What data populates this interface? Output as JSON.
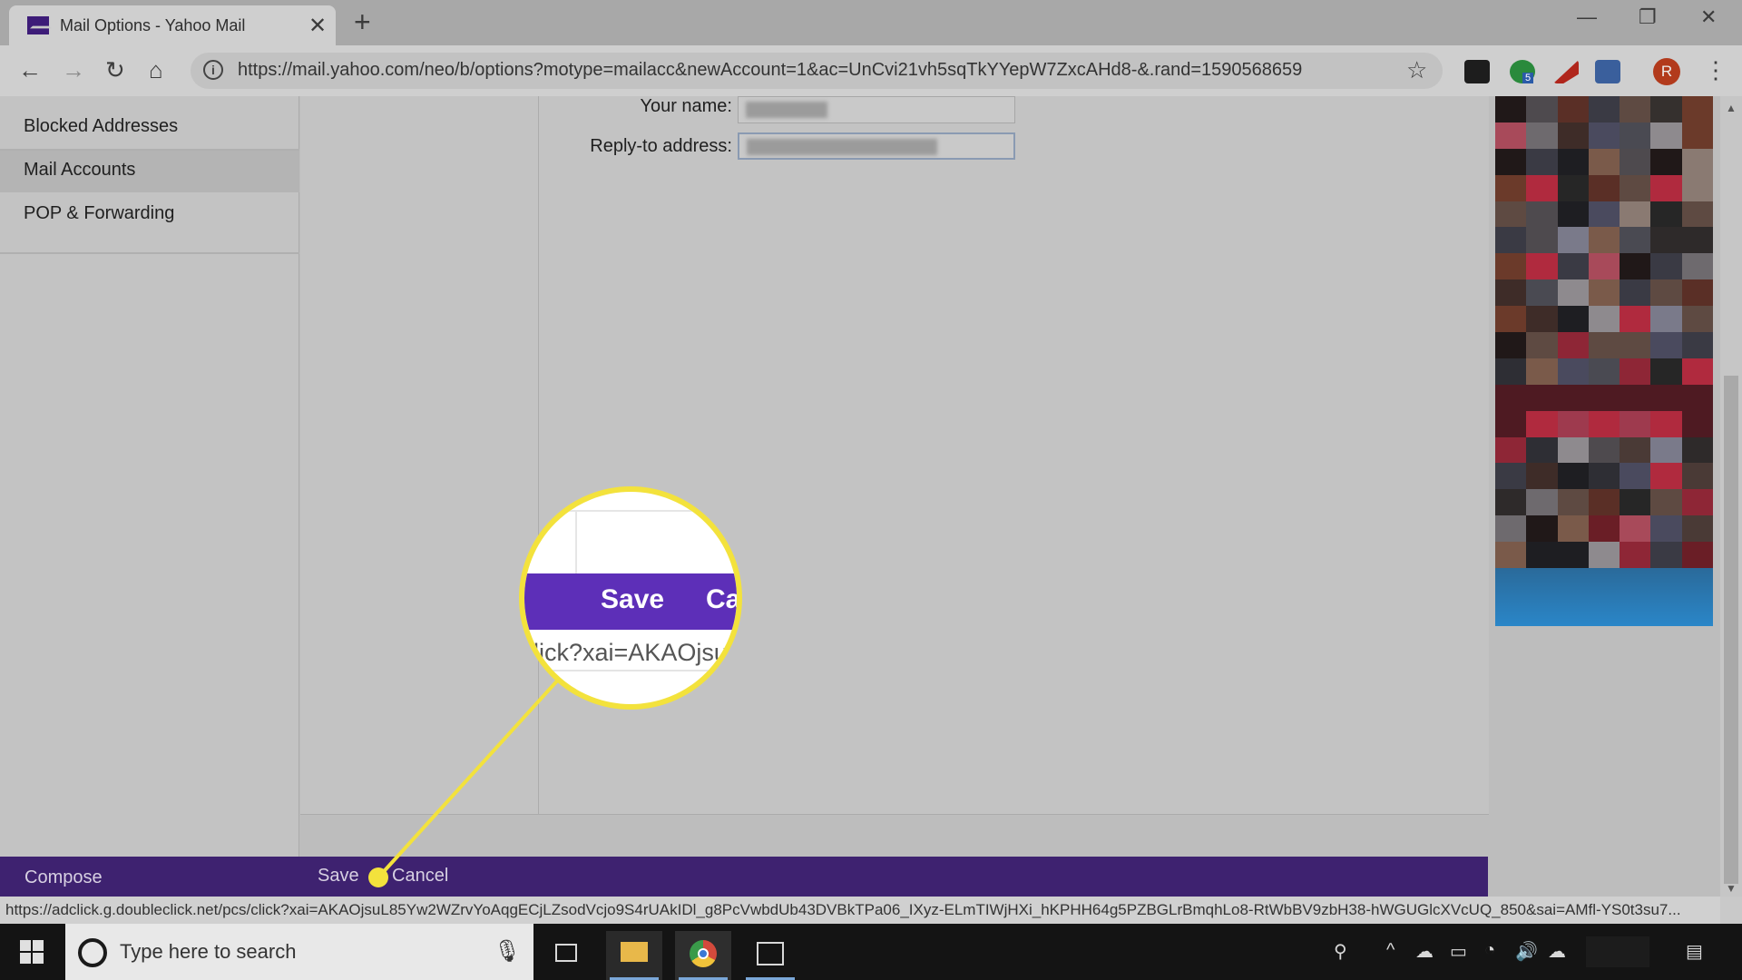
{
  "browser": {
    "tab_title": "Mail Options - Yahoo Mail",
    "tab_close": "✕",
    "new_tab": "+",
    "window": {
      "minimize": "—",
      "restore": "❐",
      "close": "✕"
    },
    "url": "https://mail.yahoo.com/neo/b/options?motype=mailacc&newAccount=1&ac=UnCvi21vh5sqTkYYepW7ZxcAHd8-&.rand=1590568659",
    "extension_badge": "5",
    "avatar_letter": "R",
    "icons": [
      "back-arrow",
      "forward-arrow",
      "reload",
      "home",
      "info",
      "star",
      "menu-dots"
    ]
  },
  "sidebar": {
    "items": [
      {
        "label": "Blocked Addresses"
      },
      {
        "label": "Mail Accounts",
        "active": true
      },
      {
        "label": "POP & Forwarding"
      }
    ]
  },
  "form": {
    "name_label": "Your name:",
    "reply_label": "Reply-to address:"
  },
  "bottom_bar": {
    "compose": "Compose",
    "save": "Save",
    "cancel": "Cancel"
  },
  "status_url": "https://adclick.g.doubleclick.net/pcs/click?xai=AKAOjsuL85Yw2WZrvYoAqgECjLZsodVcjo9S4rUAkIDl_g8PcVwbdUb43DVBkTPa06_IXyz-ELmTIWjHXi_hKPHH64g5PZBGLrBmqhLo8-RtWbBV9zbH38-hWGUGlcXVcUQ_850&sai=AMfl-YS0t3su7...",
  "callout": {
    "save": "Save",
    "cancel_partial": "Ca",
    "url_partial": "lick?xai=AKAOjsu"
  },
  "taskbar": {
    "search_placeholder": "Type here to search"
  },
  "colors": {
    "purple_bar": "#3e2270",
    "callout_purple": "#5d2fb8",
    "highlight_yellow": "#f3e23c"
  }
}
